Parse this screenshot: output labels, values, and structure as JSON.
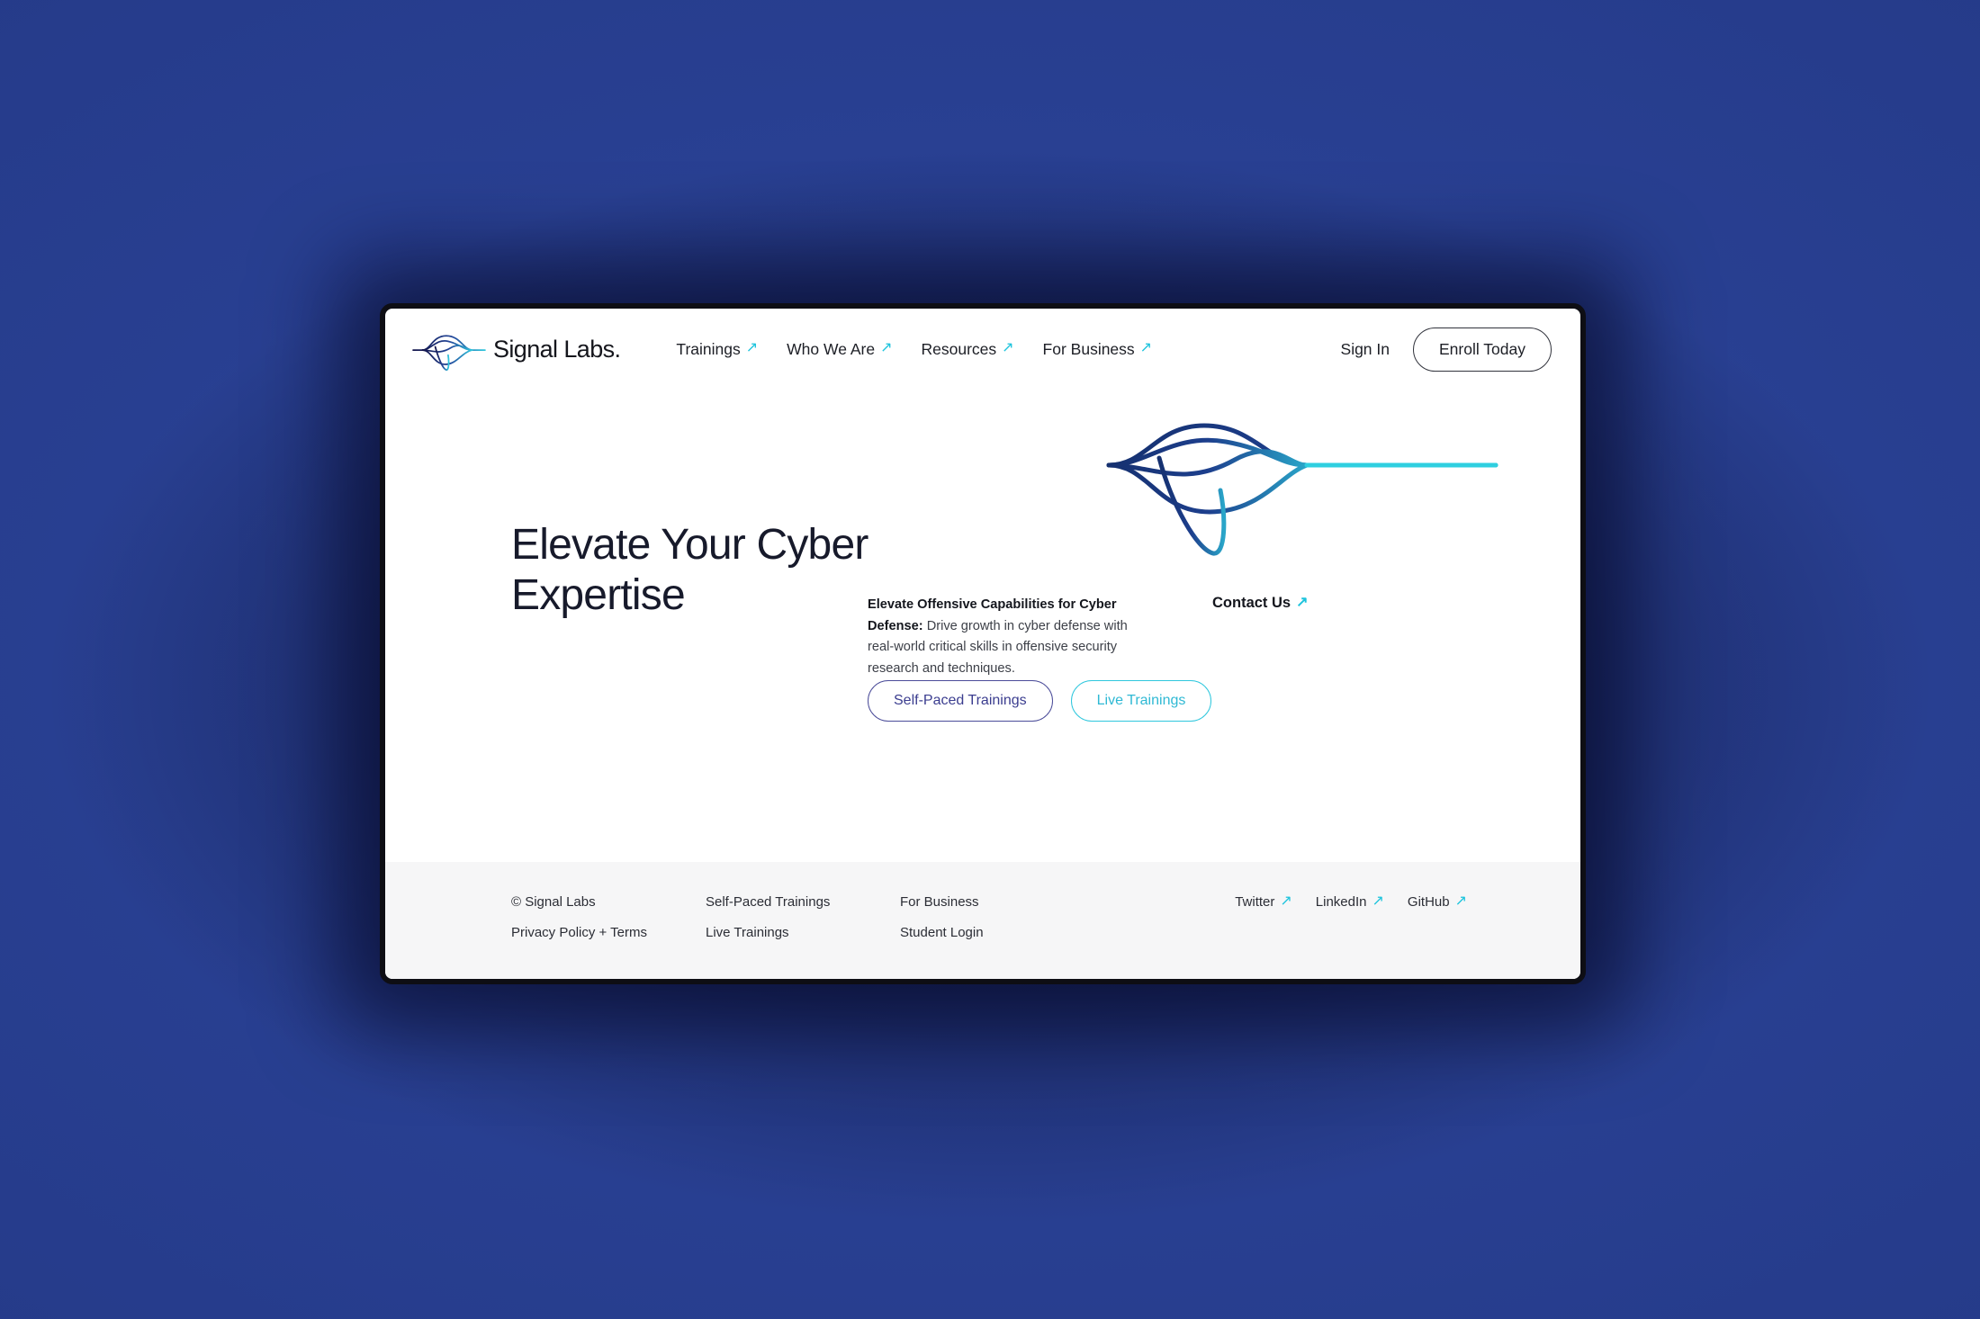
{
  "theme": {
    "backdrop_blue": "#27409a",
    "window_border": "#0e0e14",
    "accent_cyan": "#1fc4dd",
    "accent_indigo": "#3b3d8f",
    "ink": "#14161d",
    "footer_bg": "#f6f6f7"
  },
  "nav": {
    "brand": {
      "name": "Signal Labs",
      "period": ".",
      "logo_icon": "signal-wave-logo"
    },
    "links": [
      {
        "label": "Trainings",
        "icon": "arrow-up-right-icon"
      },
      {
        "label": "Who We Are",
        "icon": "arrow-up-right-icon"
      },
      {
        "label": "Resources",
        "icon": "arrow-up-right-icon"
      },
      {
        "label": "For Business",
        "icon": "arrow-up-right-icon"
      }
    ],
    "sign_in": "Sign In",
    "enroll": "Enroll Today"
  },
  "hero": {
    "title": "Elevate Your Cyber Expertise",
    "copy_bold": "Elevate Offensive Capabilities for Cyber Defense:",
    "copy_rest": " Drive growth in cyber defense with real-world critical skills in offensive security research and techniques.",
    "contact": {
      "label": "Contact Us",
      "icon": "arrow-up-right-icon"
    },
    "ctas": [
      {
        "label": "Self-Paced Trainings",
        "style": "indigo"
      },
      {
        "label": "Live Trainings",
        "style": "cyan"
      }
    ],
    "decoration": "signal-wave-banner"
  },
  "footer": {
    "col1": [
      "© Signal Labs",
      "Privacy Policy + Terms"
    ],
    "col2": [
      "Self-Paced Trainings",
      "Live Trainings"
    ],
    "col3": [
      "For Business",
      "Student Login"
    ],
    "social": [
      {
        "label": "Twitter",
        "icon": "arrow-up-right-icon"
      },
      {
        "label": "LinkedIn",
        "icon": "arrow-up-right-icon"
      },
      {
        "label": "GitHub",
        "icon": "arrow-up-right-icon"
      }
    ]
  }
}
